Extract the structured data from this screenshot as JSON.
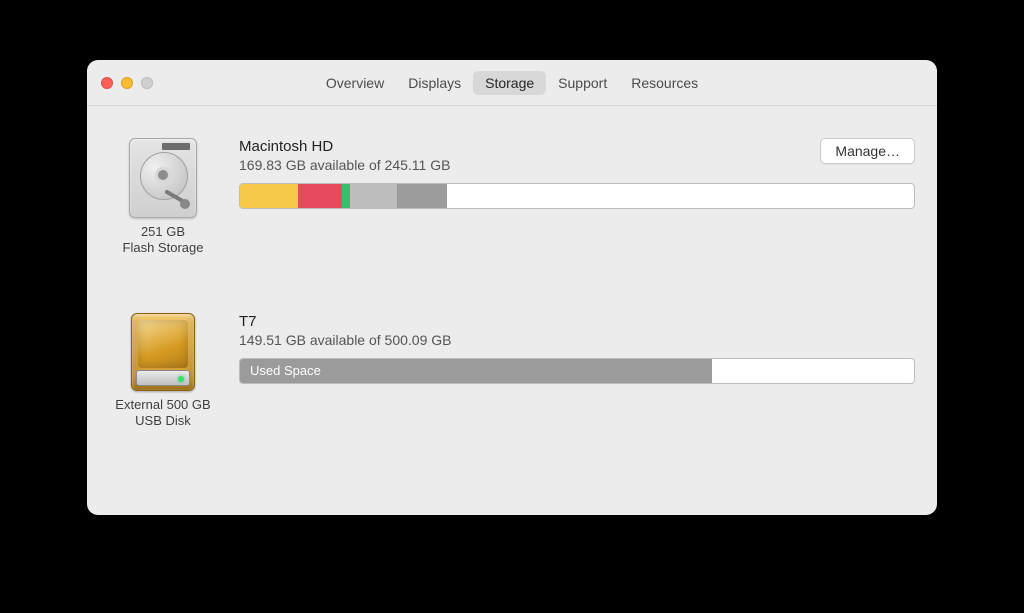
{
  "tabs": {
    "items": [
      "Overview",
      "Displays",
      "Storage",
      "Support",
      "Resources"
    ],
    "active_index": 2
  },
  "manage_button": "Manage…",
  "drives": [
    {
      "caption_line1": "251 GB",
      "caption_line2": "Flash Storage",
      "name": "Macintosh HD",
      "subtitle": "169.83 GB available of 245.11 GB",
      "segments": [
        {
          "color": "#f7c948",
          "pct": 8.6
        },
        {
          "color": "#e54b5d",
          "pct": 6.5
        },
        {
          "color": "#33c16b",
          "pct": 1.2
        },
        {
          "color": "#bdbdbd",
          "pct": 7.0
        },
        {
          "color": "#9b9b9b",
          "pct": 7.4
        }
      ],
      "has_manage": true
    },
    {
      "caption_line1": "External 500 GB",
      "caption_line2": "USB Disk",
      "name": "T7",
      "subtitle": "149.51 GB available of 500.09 GB",
      "segments": [
        {
          "color": "#9b9b9b",
          "pct": 70.1,
          "label": "Used Space"
        }
      ],
      "has_manage": false
    }
  ]
}
